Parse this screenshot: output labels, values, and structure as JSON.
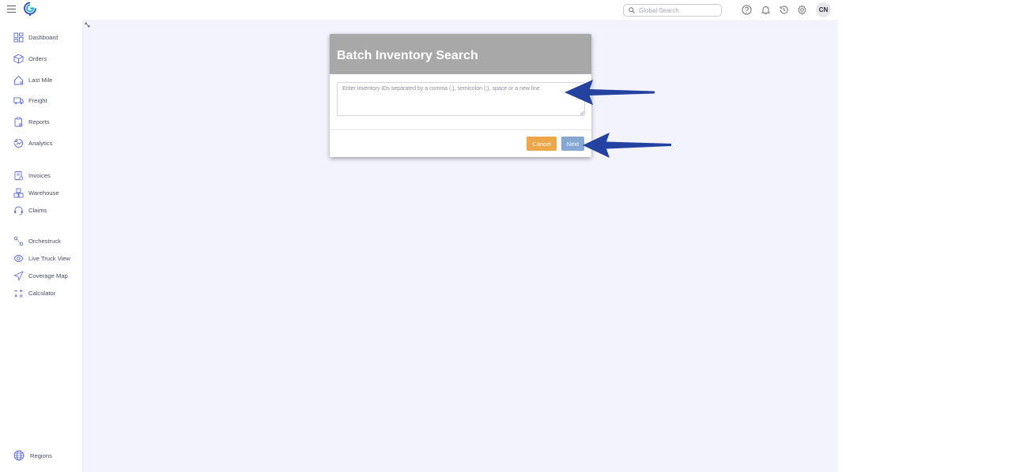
{
  "topbar": {
    "search_placeholder": "Global Search",
    "avatar_initials": "CN",
    "icons": [
      "menu-icon",
      "help-icon",
      "bell-icon",
      "history-icon",
      "settings-icon"
    ]
  },
  "sidebar": {
    "items": [
      {
        "label": "Dashboard",
        "icon": "dashboard-icon"
      },
      {
        "label": "Orders",
        "icon": "box-icon"
      },
      {
        "label": "Last Mile",
        "icon": "house-icon"
      },
      {
        "label": "Freight",
        "icon": "truck-icon"
      },
      {
        "label": "Reports",
        "icon": "report-icon"
      },
      {
        "label": "Analytics",
        "icon": "analytics-icon"
      },
      {
        "label": "Invoices",
        "icon": "invoice-icon"
      },
      {
        "label": "Warehouse",
        "icon": "warehouse-icon"
      },
      {
        "label": "Claims",
        "icon": "headset-icon"
      },
      {
        "label": "Orchestruck",
        "icon": "route-icon"
      },
      {
        "label": "Live Truck View",
        "icon": "eye-icon"
      },
      {
        "label": "Coverage Map",
        "icon": "navigation-icon"
      },
      {
        "label": "Calculator",
        "icon": "calculator-icon"
      }
    ],
    "footer": {
      "label": "Regions",
      "icon": "globe-icon"
    }
  },
  "modal": {
    "title": "Batch Inventory Search",
    "textarea_placeholder": "Enter Inventory IDs separated by a comma (,), semicolon (;), space or a new line",
    "textarea_value": "",
    "cancel_label": "Cancel",
    "next_label": "Next"
  },
  "colors": {
    "accent": "#5a6bd8",
    "main_bg": "#f3f3fd",
    "modal_header": "#a8a8a8",
    "cancel_button": "#eea64a",
    "next_button": "#86a7d1",
    "annotation_arrow": "#2442a0"
  }
}
